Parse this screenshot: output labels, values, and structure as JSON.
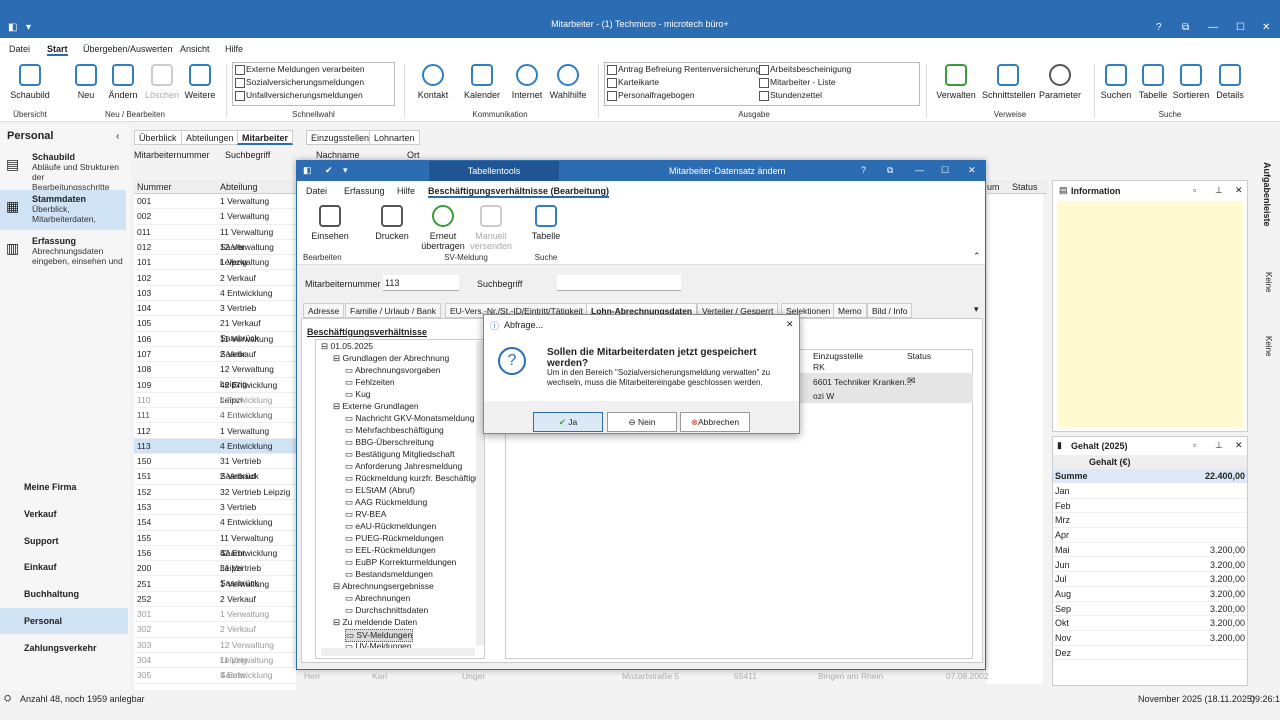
{
  "window": {
    "title": "Mitarbeiter - (1) Techmicro - microtech büro+",
    "help": "?",
    "restore": "⧉",
    "min": "—",
    "max": "☐",
    "close": "✕"
  },
  "menu": [
    "Datei",
    "Start",
    "Übergeben/Auswerten",
    "Ansicht",
    "Hilfe"
  ],
  "ribbon": {
    "buttons": [
      "Schaubild",
      "Neu",
      "Ändern",
      "Löschen",
      "Weitere",
      "Kontakt",
      "Kalender",
      "Internet",
      "Wahlhilfe",
      "Verwalten",
      "Schnittstellen",
      "Parameter",
      "Suchen",
      "Tabelle",
      "Sortieren",
      "Details"
    ],
    "groups": [
      "Übersicht",
      "Neu / Bearbeiten",
      "Schnellwahl",
      "Kommunikation",
      "Ausgabe",
      "Verweise",
      "Suche"
    ],
    "schnellwahl": [
      "Externe Meldungen verarbeiten",
      "Sozialversicherungsmeldungen",
      "Unfallversicherungsmeldungen"
    ],
    "ausgabe_left": [
      "Antrag Befreiung Rentenversicherung",
      "Karteikarte",
      "Personalfragebogen"
    ],
    "ausgabe_right": [
      "Arbeitsbescheinigung",
      "Mitarbeiter - Liste",
      "Stundenzettel"
    ]
  },
  "left": {
    "title": "Personal",
    "items": [
      {
        "label": "Schaubild",
        "sub": "Abläufe und Strukturen der Bearbeitungsschritte"
      },
      {
        "label": "Stammdaten",
        "sub": "Überblick, Mitarbeiterdaten,"
      },
      {
        "label": "Erfassung",
        "sub": "Abrechnungsdaten eingeben, einsehen und"
      }
    ],
    "bottom": [
      "Meine Firma",
      "Verkauf",
      "Support",
      "Einkauf",
      "Buchhaltung",
      "Personal",
      "Zahlungsverkehr"
    ]
  },
  "tabs": [
    "Überblick",
    "Abteilungen",
    "Mitarbeiter",
    "Einzugsstellen",
    "Lohnarten"
  ],
  "filter": [
    "Mitarbeiternummer",
    "Suchbegriff",
    "Nachname",
    "Ort"
  ],
  "grid": {
    "headers": [
      "Nummer",
      "Abteilung"
    ],
    "rows": [
      [
        "001",
        "1 Verwaltung"
      ],
      [
        "002",
        "1 Verwaltung"
      ],
      [
        "011",
        "11 Verwaltung Saarbr."
      ],
      [
        "012",
        "12 Verwaltung Leipzig"
      ],
      [
        "101",
        "1 Verwaltung"
      ],
      [
        "102",
        "2 Verkauf"
      ],
      [
        "103",
        "4 Entwicklung"
      ],
      [
        "104",
        "3 Vertrieb"
      ],
      [
        "105",
        "21 Verkauf Saarbrück"
      ],
      [
        "106",
        "11 Verwaltung Saarbr."
      ],
      [
        "107",
        "2 Verkauf"
      ],
      [
        "108",
        "12 Verwaltung Leipzig"
      ],
      [
        "109",
        "42 Entwicklung Leipzi"
      ],
      [
        "110",
        "4 Entwicklung"
      ],
      [
        "111",
        "4 Entwicklung"
      ],
      [
        "112",
        "1 Verwaltung"
      ],
      [
        "113",
        "4 Entwicklung"
      ],
      [
        "150",
        "31 Vertrieb Saarbrück"
      ],
      [
        "151",
        "2 Verkauf"
      ],
      [
        "152",
        "32 Vertrieb Leipzig"
      ],
      [
        "153",
        "3 Vertrieb"
      ],
      [
        "154",
        "4 Entwicklung"
      ],
      [
        "155",
        "11 Verwaltung Saarbr."
      ],
      [
        "156",
        "42 Entwicklung Leipzi"
      ],
      [
        "200",
        "31 Vertrieb Saarbrück"
      ],
      [
        "251",
        "1 Verwaltung"
      ],
      [
        "252",
        "2 Verkauf"
      ],
      [
        "301",
        "1 Verwaltung"
      ],
      [
        "302",
        "2 Verkauf"
      ],
      [
        "303",
        "12 Verwaltung Leipzig"
      ],
      [
        "304",
        "11 Verwaltung Saarbr."
      ],
      [
        "305",
        "4 Entwicklung"
      ]
    ],
    "last_row": [
      "Herr",
      "Karl",
      "Unger",
      "Mozartstraße 5",
      "55411",
      "Bingen am Rhein",
      "07.08.2002"
    ]
  },
  "dialog": {
    "title": "Mitarbeiter-Datensatz ändern",
    "context": "Tabellentools",
    "menu": [
      "Datei",
      "Erfassung",
      "Hilfe",
      "Beschäftigungsverhältnisse (Bearbeitung)"
    ],
    "buttons": [
      "Einsehen",
      "Drucken",
      "Erneut übertragen",
      "Manuell versenden",
      "Tabelle"
    ],
    "groups": [
      "Bearbeiten",
      "SV-Meldung",
      "Suche"
    ],
    "nr_label": "Mitarbeiternummer",
    "nr_value": "113",
    "such_label": "Suchbegriff",
    "tabs": [
      "Adresse",
      "Familie / Urlaub / Bank",
      "EU-Vers.-Nr./St.-ID/Eintritt/Tätigkeit",
      "Lohn-Abrechnungsdaten",
      "Verteiler / Gesperrt",
      "Selektionen",
      "Memo",
      "Bild / Info"
    ],
    "tree_title": "Beschäftigungsverhältnisse",
    "tree": [
      "01.05.2025",
      "Grundlagen der Abrechnung",
      "Abrechnungsvorgaben",
      "Fehlzeiten",
      "Kug",
      "Externe Grundlagen",
      "Nachricht GKV-Monatsmeldung",
      "Mehrfachbeschäftigung",
      "BBG-Überschreitung",
      "Bestätigung Mitgliedschaft",
      "Anforderung Jahresmeldung",
      "Rückmeldung kurzfr. Beschäftigu",
      "ELStAM (Abruf)",
      "AAG Rückmeldung",
      "RV-BEA",
      "eAU-Rückmeldungen",
      "PUEG-Rückmeldungen",
      "EEL-Rückmeldungen",
      "EuBP Korrekturmeldungen",
      "Bestandsmeldungen",
      "Abrechnungsergebnisse",
      "Abrechnungen",
      "Durchschnittsdaten",
      "Zu meldende Daten",
      "SV-Meldungen",
      "UV-Meldungen"
    ],
    "table_headers": [
      "Einzugsstelle",
      "Status"
    ],
    "table_row": [
      "RK",
      "6601 Techniker Kranken...",
      "ozi W"
    ]
  },
  "msgbox": {
    "title": "Abfrage...",
    "question": "Sollen die Mitarbeiterdaten jetzt gespeichert werden?",
    "text1": "Um in den Bereich \"Sozialversicherungsmeldung verwalten\" zu",
    "text2": "wechseln, muss die Mitarbeitereingabe geschlossen werden.",
    "yes": "Ja",
    "no": "Nein",
    "cancel": "Abbrechen",
    "close": "✕"
  },
  "right": {
    "status_col": "Status",
    "um_col": "um",
    "info": "Information",
    "gehalt_title": "Gehalt (2025)",
    "gehalt_col": "Gehalt (€)",
    "summe_label": "Summe",
    "summe": "22.400,00",
    "months": [
      [
        "Jan",
        ""
      ],
      [
        "Feb",
        ""
      ],
      [
        "Mrz",
        ""
      ],
      [
        "Apr",
        ""
      ],
      [
        "Mai",
        "3.200,00"
      ],
      [
        "Jun",
        "3.200,00"
      ],
      [
        "Jul",
        "3.200,00"
      ],
      [
        "Aug",
        "3.200,00"
      ],
      [
        "Sep",
        "3.200,00"
      ],
      [
        "Okt",
        "3.200,00"
      ],
      [
        "Nov",
        "3.200,00"
      ],
      [
        "Dez",
        ""
      ]
    ],
    "side": [
      "Aufgabenleiste",
      "Keine",
      "Keine"
    ]
  },
  "statusbar": {
    "left": "Anzahl 48, noch 1959 anlegbar",
    "period": "November 2025  (18.11.2025)",
    "time": "09:26:14"
  }
}
